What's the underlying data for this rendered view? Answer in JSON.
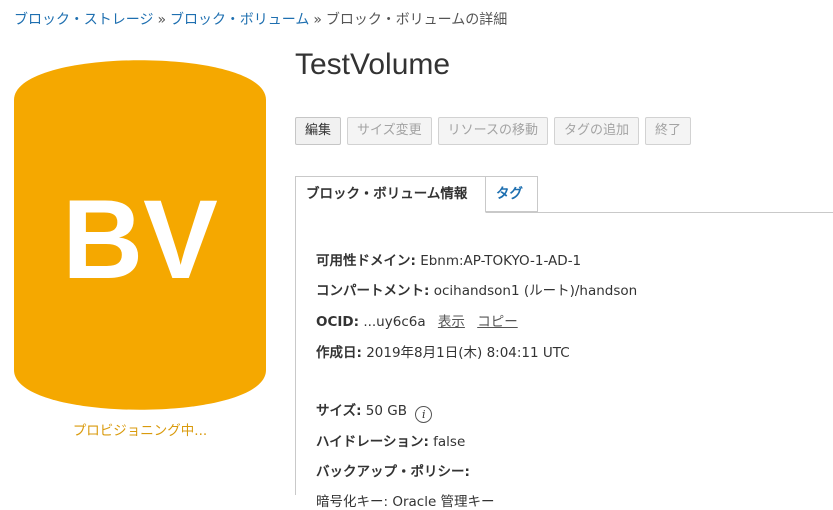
{
  "breadcrumb": {
    "item1": "ブロック・ストレージ",
    "item2": "ブロック・ボリューム",
    "current": "ブロック・ボリュームの詳細",
    "separator": "»"
  },
  "volume": {
    "badge_text": "BV",
    "status": "プロビジョニング中...",
    "name": "TestVolume",
    "badge_color": "#f5a800"
  },
  "actions": {
    "edit": "編集",
    "resize": "サイズ変更",
    "move": "リソースの移動",
    "add_tags": "タグの追加",
    "terminate": "終了"
  },
  "tabs": {
    "info": "ブロック・ボリューム情報",
    "tags": "タグ"
  },
  "details": {
    "availability_domain_label": "可用性ドメイン:",
    "availability_domain_value": "Ebnm:AP-TOKYO-1-AD-1",
    "compartment_label": "コンパートメント:",
    "compartment_value": "ocihandson1 (ルート)/handson",
    "ocid_label": "OCID:",
    "ocid_value": "...uy6c6a",
    "show_link": "表示",
    "copy_link": "コピー",
    "created_label": "作成日:",
    "created_value": "2019年8月1日(木) 8:04:11 UTC",
    "size_label": "サイズ:",
    "size_value": "50 GB",
    "info_icon_glyph": "i",
    "hydration_label": "ハイドレーション:",
    "hydration_value": "false",
    "backup_policy_label": "バックアップ・ポリシー:",
    "encryption_partial": "暗号化キー: Oracle 管理キー"
  }
}
